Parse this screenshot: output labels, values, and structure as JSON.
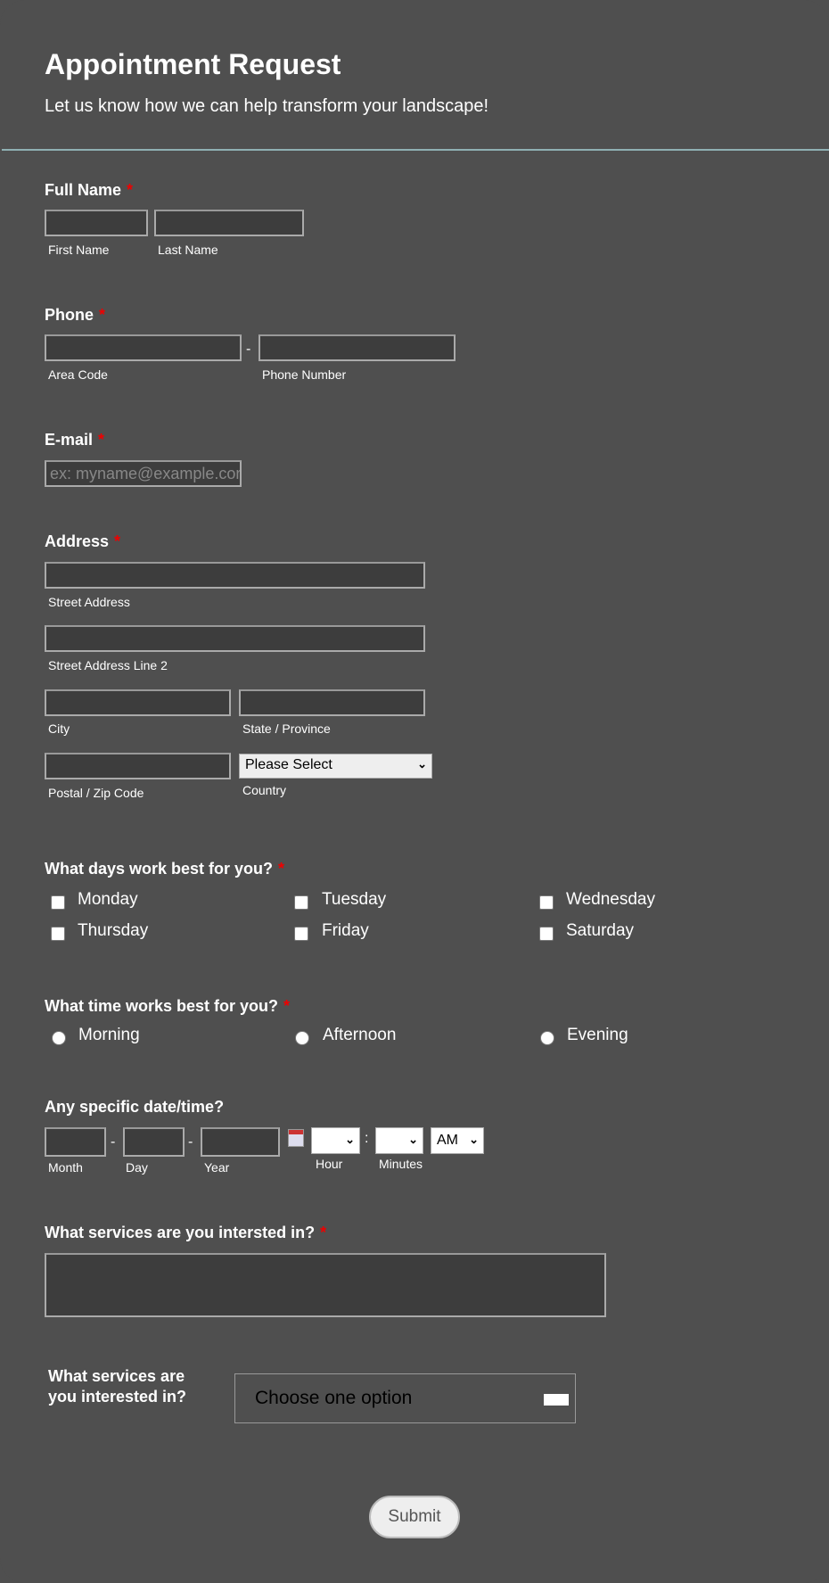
{
  "header": {
    "title": "Appointment Request",
    "subtitle": "Let us know how we can help transform your landscape!"
  },
  "full_name": {
    "label": "Full Name",
    "required": "*",
    "first": "First Name",
    "last": "Last Name"
  },
  "phone": {
    "label": "Phone",
    "required": "*",
    "area": "Area Code",
    "number": "Phone Number",
    "sep": "-"
  },
  "email": {
    "label": "E-mail",
    "required": "*",
    "placeholder": "ex: myname@example.com"
  },
  "address": {
    "label": "Address",
    "required": "*",
    "street": "Street Address",
    "street2": "Street Address Line 2",
    "city": "City",
    "state": "State / Province",
    "postal": "Postal / Zip Code",
    "country": "Country",
    "country_value": "Please Select"
  },
  "days": {
    "label": "What days work best for you?",
    "required": "*",
    "options": [
      "Monday",
      "Tuesday",
      "Wednesday",
      "Thursday",
      "Friday",
      "Saturday"
    ]
  },
  "time": {
    "label": "What time works best for you?",
    "required": "*",
    "options": [
      "Morning",
      "Afternoon",
      "Evening"
    ]
  },
  "datetime": {
    "label": "Any specific date/time?",
    "month": "Month",
    "day": "Day",
    "year": "Year",
    "hour": "Hour",
    "minutes": "Minutes",
    "ampm": "AM",
    "dash": "-",
    "colon": ":"
  },
  "services": {
    "label": "What services are you intersted in?",
    "required": "*"
  },
  "services2": {
    "label_line1": "What services are",
    "label_line2": "you interested in?",
    "value": "Choose one option"
  },
  "submit": "Submit"
}
